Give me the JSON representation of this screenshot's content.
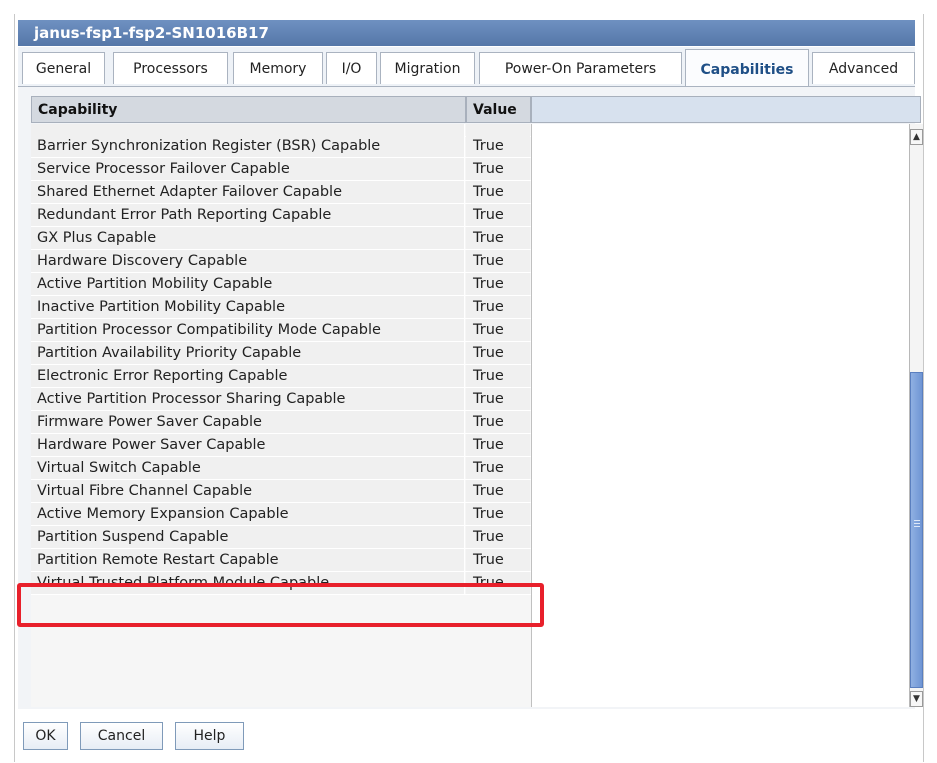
{
  "window": {
    "title": "janus-fsp1-fsp2-SN1016B17"
  },
  "tabs": [
    {
      "label": "General"
    },
    {
      "label": "Processors"
    },
    {
      "label": "Memory"
    },
    {
      "label": "I/O"
    },
    {
      "label": "Migration"
    },
    {
      "label": "Power-On Parameters"
    },
    {
      "label": "Capabilities",
      "active": true
    },
    {
      "label": "Advanced"
    }
  ],
  "table": {
    "columns": {
      "capability": "Capability",
      "value": "Value"
    },
    "rows": [
      {
        "capability": "Barrier Synchronization Register (BSR) Capable",
        "value": "True"
      },
      {
        "capability": "Service Processor Failover Capable",
        "value": "True"
      },
      {
        "capability": "Shared Ethernet Adapter Failover Capable",
        "value": "True"
      },
      {
        "capability": "Redundant Error Path Reporting Capable",
        "value": "True"
      },
      {
        "capability": "GX Plus Capable",
        "value": "True"
      },
      {
        "capability": "Hardware Discovery Capable",
        "value": "True"
      },
      {
        "capability": "Active Partition Mobility Capable",
        "value": "True"
      },
      {
        "capability": "Inactive Partition Mobility Capable",
        "value": "True"
      },
      {
        "capability": "Partition Processor Compatibility Mode Capable",
        "value": "True"
      },
      {
        "capability": "Partition Availability Priority Capable",
        "value": "True"
      },
      {
        "capability": "Electronic Error Reporting Capable",
        "value": "True"
      },
      {
        "capability": "Active Partition Processor Sharing Capable",
        "value": "True"
      },
      {
        "capability": "Firmware Power Saver Capable",
        "value": "True"
      },
      {
        "capability": "Hardware Power Saver Capable",
        "value": "True"
      },
      {
        "capability": "Virtual Switch Capable",
        "value": "True"
      },
      {
        "capability": "Virtual Fibre Channel Capable",
        "value": "True"
      },
      {
        "capability": "Active Memory Expansion Capable",
        "value": "True",
        "highlighted": true
      },
      {
        "capability": "Partition Suspend Capable",
        "value": "True"
      },
      {
        "capability": "Partition Remote Restart Capable",
        "value": "True"
      },
      {
        "capability": "Virtual Trusted Platform Module Capable",
        "value": "True"
      }
    ]
  },
  "scrollbar": {
    "up_icon": "chevron-up-icon",
    "down_icon": "chevron-down-icon",
    "grip_icon": "grip-icon"
  },
  "buttons": {
    "ok": "OK",
    "cancel": "Cancel",
    "help": "Help"
  },
  "colors": {
    "title_bar": "#5f82b5",
    "active_tab_text": "#1f4f86",
    "highlight_box": "#e8202b",
    "scroll_thumb": "#7da0da"
  }
}
